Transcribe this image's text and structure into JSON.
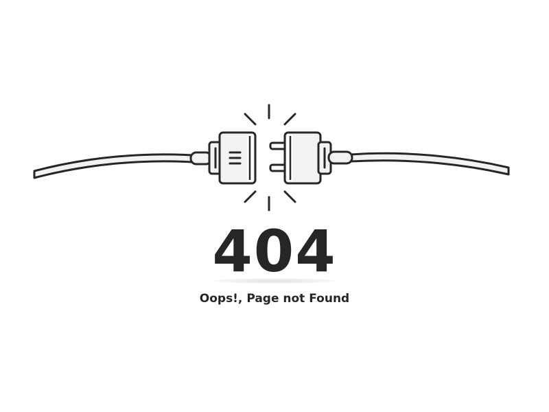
{
  "error": {
    "code": "404",
    "message": "Oops!, Page not Found"
  },
  "illustration": {
    "icon": "unplugged-cable-icon",
    "colors": {
      "outline": "#262626",
      "fill": "#f2f2f2",
      "background": "#ffffff"
    }
  }
}
